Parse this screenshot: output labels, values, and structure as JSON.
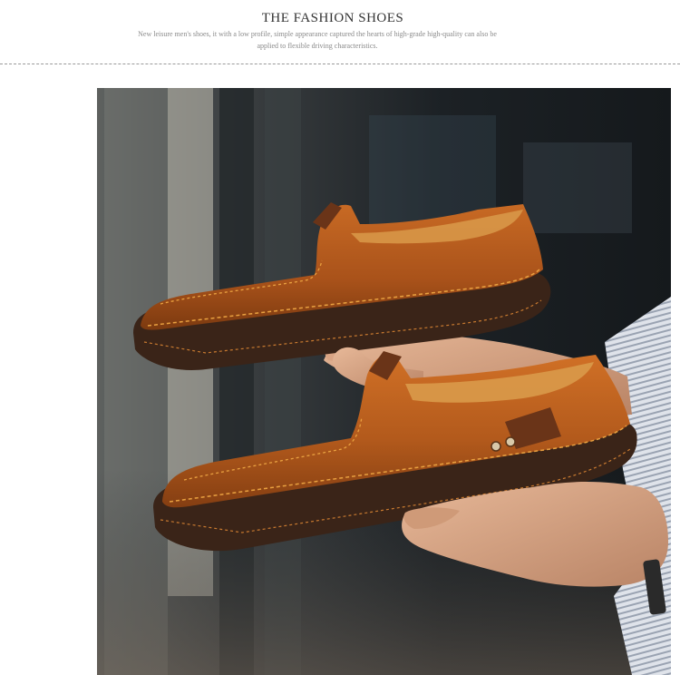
{
  "header": {
    "title": "THE FASHION SHOES",
    "subtitle": "New leisure men's shoes, it with a low profile, simple appearance captured the hearts of high-grade high-quality can also be applied to flexible driving characteristics."
  },
  "photo": {
    "subject": "two-loafers-held-in-hands",
    "colors": {
      "leather": "#b0581c",
      "sole": "#3a2418",
      "stitch": "#e8a040",
      "background": "#1e2226"
    }
  }
}
